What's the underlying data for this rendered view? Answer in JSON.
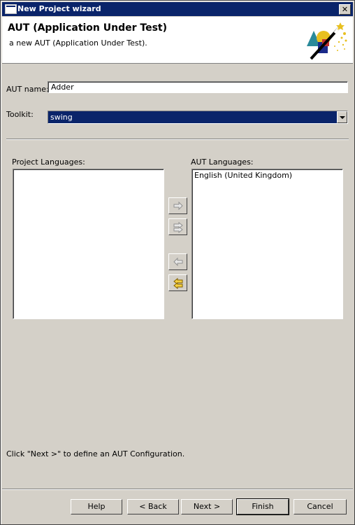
{
  "window": {
    "title": "New Project wizard"
  },
  "header": {
    "title": "AUT (Application Under Test)",
    "description": "a new AUT (Application Under Test)."
  },
  "form": {
    "aut_name_label": "AUT name:",
    "aut_name_value": "Adder",
    "toolkit_label": "Toolkit:",
    "toolkit_value": "swing"
  },
  "languages": {
    "project_label": "Project Languages:",
    "project_items": [],
    "aut_label": "AUT Languages:",
    "aut_items": [
      "English (United Kingdom)"
    ]
  },
  "hint": "Click \"Next >\" to define an AUT Configuration.",
  "buttons": {
    "help": "Help",
    "back": "< Back",
    "next": "Next >",
    "finish": "Finish",
    "cancel": "Cancel"
  },
  "icons": {
    "close": "close-icon",
    "add": "add-arrow-icon",
    "add_all": "add-all-arrow-icon",
    "remove": "remove-arrow-icon",
    "remove_all": "remove-all-arrow-icon"
  }
}
